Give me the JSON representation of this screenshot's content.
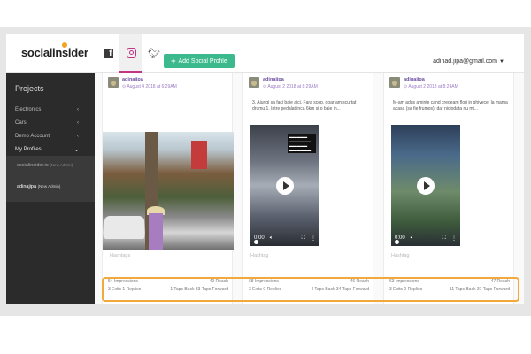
{
  "header": {
    "logo": "socialinsider",
    "add_button_label": "Add Social Profile",
    "user_email": "adinad.jipa@gmail.com"
  },
  "social_tabs": [
    {
      "name": "facebook-icon",
      "active": false
    },
    {
      "name": "instagram-icon",
      "active": true
    },
    {
      "name": "twitter-icon",
      "active": false
    }
  ],
  "sidebar": {
    "title": "Projects",
    "items": [
      {
        "label": "Electronics",
        "chevron": "‹"
      },
      {
        "label": "Cars",
        "chevron": "‹"
      },
      {
        "label": "Demo Account",
        "chevron": "‹"
      },
      {
        "label": "My Profiles",
        "chevron": "⌄"
      }
    ],
    "profiles": [
      {
        "label": "socialinsider.io",
        "tag": "(New Admin)"
      },
      {
        "label": "adinajipa",
        "tag": "(New Admin)"
      }
    ]
  },
  "cards": [
    {
      "username": "adinajipa",
      "date": "August 4 2018 at 6:29AM",
      "caption": "",
      "hashtags": "Hashtags",
      "impressions": "54 Impressions",
      "reach": "49 Reach",
      "exits_replies": "3 Exits 1 Replies",
      "taps": "1 Taps Back 33 Taps Forward"
    },
    {
      "username": "adinajipa",
      "date": "August 2 2018 at 8:29AM",
      "caption": "3. Ajungi sa faci baie aici. Fara scop, doar am scurtat drumu 1. Intre pedalat inca 6km si o baie in...",
      "video_time": "0:00",
      "hashtags": "Hashtag",
      "impressions": "68 Impressions",
      "reach": "46 Reach",
      "exits_replies": "3 Exits 0 Replies",
      "taps": "4 Taps Back 34 Taps Forward"
    },
    {
      "username": "adinajipa",
      "date": "August 2 2018 at 8:24AM",
      "caption": "M-am adus aminte cand credeam flori in ghivece, la mama acasa (sa fie frumos), dar niciodata nu mi...",
      "video_time": "0:00",
      "hashtags": "Hashtag",
      "impressions": "63 Impressions",
      "reach": "47 Reach",
      "exits_replies": "3 Exits 0 Replies",
      "taps": "11 Taps Back 37 Taps Forward"
    }
  ],
  "accent_colors": {
    "highlight": "#f2a93b",
    "add_button": "#3dba8d",
    "username": "#6b4fa0"
  }
}
